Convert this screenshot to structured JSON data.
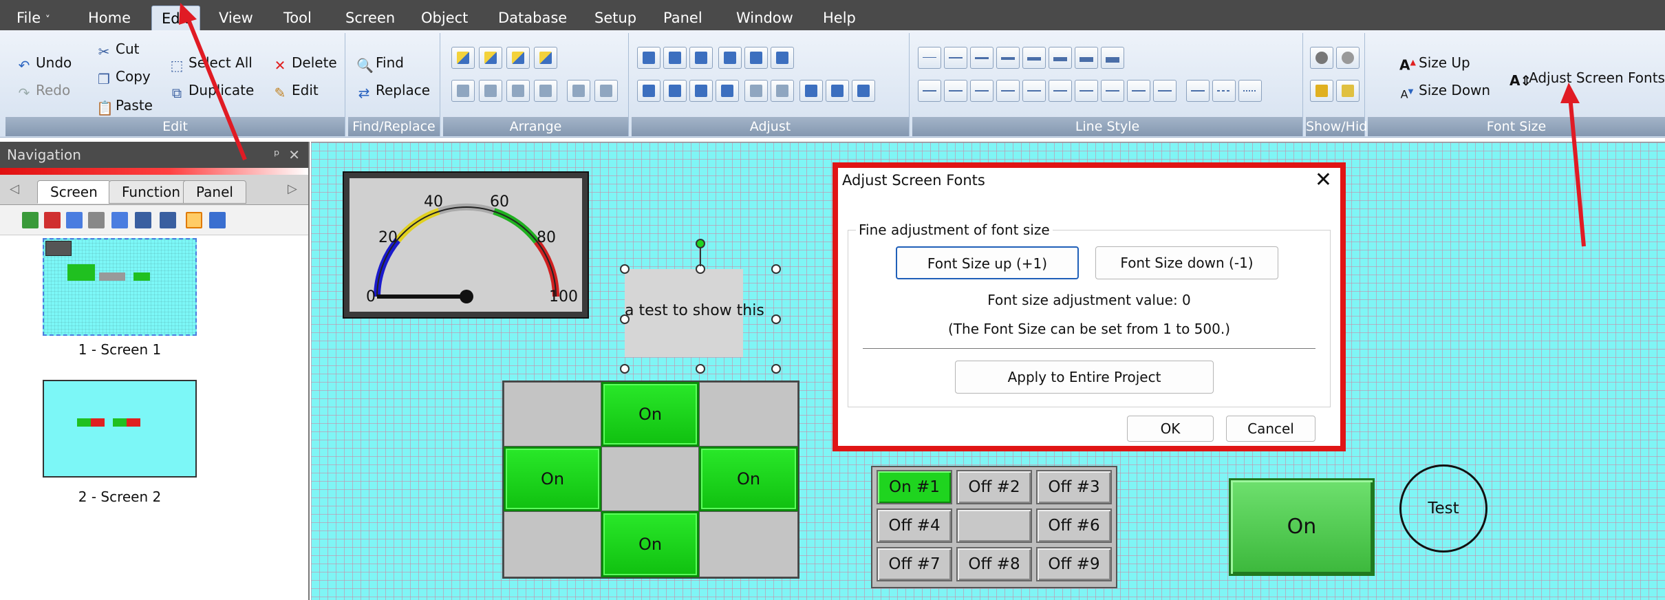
{
  "menubar": {
    "items": [
      "File",
      "Home",
      "Edit",
      "View",
      "Tool",
      "Screen",
      "Object",
      "Database",
      "Setup",
      "Panel",
      "Window",
      "Help"
    ],
    "file_caret": "˅"
  },
  "ribbon": {
    "edit": {
      "undo": "Undo",
      "redo": "Redo",
      "cut": "Cut",
      "copy": "Copy",
      "paste": "Paste",
      "select_all": "Select All",
      "duplicate": "Duplicate",
      "delete": "Delete",
      "edit": "Edit",
      "title": "Edit"
    },
    "find_replace": {
      "find": "Find",
      "replace": "Replace",
      "title": "Find/Replace"
    },
    "arrange": {
      "title": "Arrange"
    },
    "adjust": {
      "title": "Adjust"
    },
    "line_style": {
      "title": "Line Style"
    },
    "show_hide": {
      "title": "Show/Hide"
    },
    "font_size": {
      "size_up": "Size Up",
      "size_down": "Size Down",
      "adjust_screen_fonts": "Adjust Screen Fonts",
      "title": "Font Size"
    }
  },
  "navigation": {
    "title": "Navigation",
    "pin": "ᵖ",
    "close": "✕",
    "tabs": [
      "Screen",
      "Function",
      "Panel"
    ],
    "screens": [
      "1 - Screen 1",
      "2 - Screen 2"
    ]
  },
  "canvas": {
    "gauge": {
      "ticks": [
        "0",
        "20",
        "40",
        "60",
        "80",
        "100"
      ],
      "value": 0
    },
    "text_object": "a test to show this",
    "matrix": {
      "on_label": "On"
    },
    "keypad": [
      "On #1",
      "Off #2",
      "Off #3",
      "Off #4",
      "",
      "Off #6",
      "Off #7",
      "Off #8",
      "Off #9"
    ],
    "big_button": "On",
    "circle_label": "Test"
  },
  "dialog": {
    "title": "Adjust Screen Fonts",
    "close": "✕",
    "group_label": "Fine adjustment of font size",
    "size_up": "Font Size up (+1)",
    "size_down": "Font Size down (-1)",
    "adjust_value": "Font size adjustment value: 0",
    "range_note": "(The Font Size can be set from 1 to 500.)",
    "apply": "Apply to Entire Project",
    "ok": "OK",
    "cancel": "Cancel"
  },
  "colors": {
    "accent_red": "#e01515",
    "canvas": "#7ff5f5",
    "on_green": "#1fd41f"
  }
}
